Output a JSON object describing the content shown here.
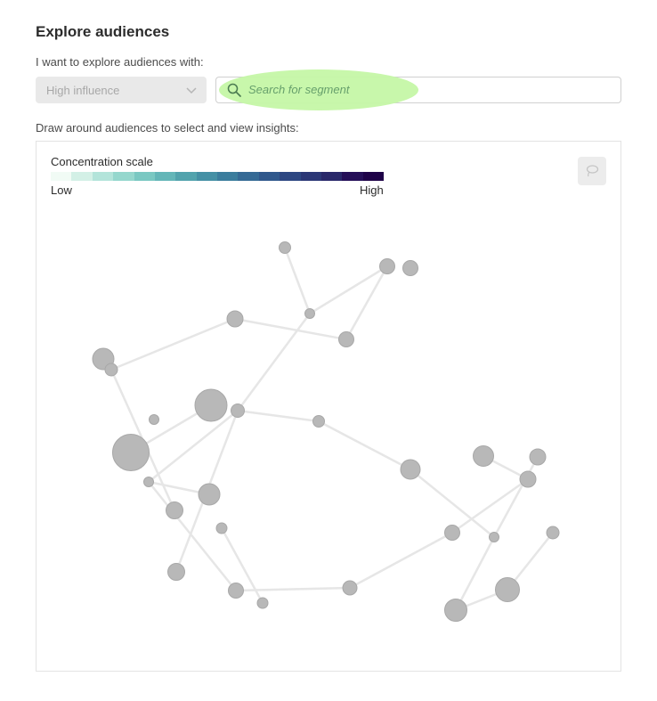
{
  "header": {
    "title": "Explore audiences"
  },
  "explore": {
    "prompt": "I want to explore audiences with:",
    "select_value": "High influence",
    "search_placeholder": "Search for segment"
  },
  "canvas": {
    "instruction": "Draw around audiences to select and view insights:",
    "scale_title": "Concentration scale",
    "scale_low": "Low",
    "scale_high": "High",
    "scale_colors": [
      "#f1fbf5",
      "#d3f0e6",
      "#b3e4da",
      "#95d7cd",
      "#7ac8c2",
      "#64b6b8",
      "#52a3ad",
      "#4590a5",
      "#3b7d9d",
      "#356a95",
      "#30588c",
      "#2d4782",
      "#2b3776",
      "#29286a",
      "#250f58",
      "#1e0248"
    ],
    "node_color": "#b8b8b8",
    "edge_color": "#e6e6e6",
    "lasso_icon": "lasso-icon"
  }
}
